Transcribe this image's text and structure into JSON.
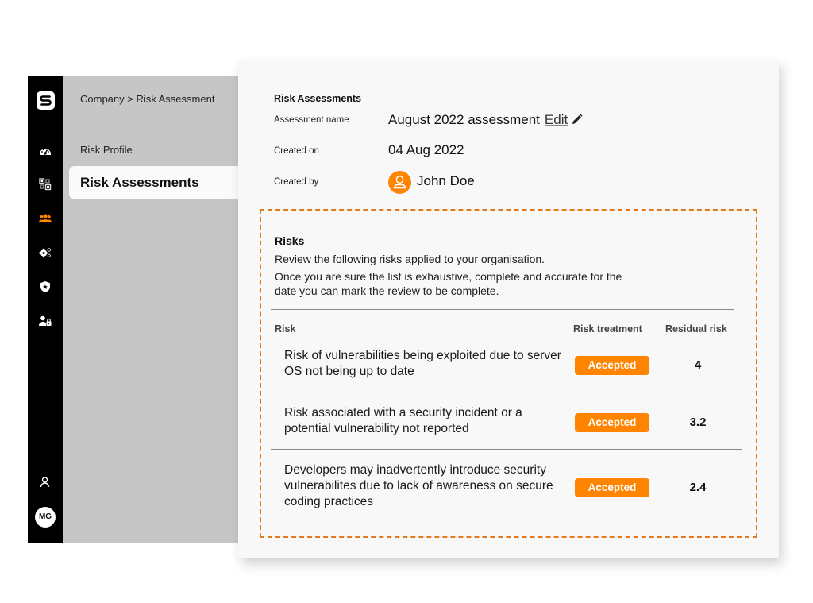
{
  "rail": {
    "logo_letter": "S",
    "icons": [
      {
        "name": "dashboard-gauge-icon",
        "active": false
      },
      {
        "name": "integrations-icon",
        "active": false
      },
      {
        "name": "people-icon",
        "active": true
      },
      {
        "name": "settings-gears-icon",
        "active": false
      },
      {
        "name": "shield-icon",
        "active": false
      },
      {
        "name": "user-lock-icon",
        "active": false
      }
    ],
    "account_icon": "user-icon",
    "avatar_initials": "MG",
    "accent_color": "#ff8400"
  },
  "nav": {
    "breadcrumb": "Company > Risk Assessment",
    "items": [
      {
        "label": "Risk Profile",
        "active": false
      },
      {
        "label": "Risk Assessments",
        "active": true
      }
    ]
  },
  "assessment": {
    "section_title": "Risk Assessments",
    "name_label": "Assessment name",
    "name_value": "August 2022 assessment",
    "edit_label": "Edit",
    "created_on_label": "Created on",
    "created_on_value": "04 Aug 2022",
    "created_by_label": "Created by",
    "created_by_value": "John Doe"
  },
  "risks": {
    "title": "Risks",
    "description_1": "Review the following risks applied to your organisation.",
    "description_2": "Once you are sure the list is exhaustive, complete and accurate for the date you can mark the review to be complete.",
    "columns": {
      "risk": "Risk",
      "treatment": "Risk treatment",
      "residual": "Residual risk"
    },
    "rows": [
      {
        "risk": "Risk of vulnerabilities being exploited due to server OS not being up to date",
        "treatment": "Accepted",
        "residual": "4"
      },
      {
        "risk": "Risk associated with a security incident or a potential vulnerability not reported",
        "treatment": "Accepted",
        "residual": "3.2"
      },
      {
        "risk": "Developers may inadvertently introduce security vulnerabilites due to lack of awareness on secure coding practices",
        "treatment": "Accepted",
        "residual": "2.4"
      }
    ],
    "badge_color": "#ff8400",
    "border_color": "#e07a1c"
  }
}
